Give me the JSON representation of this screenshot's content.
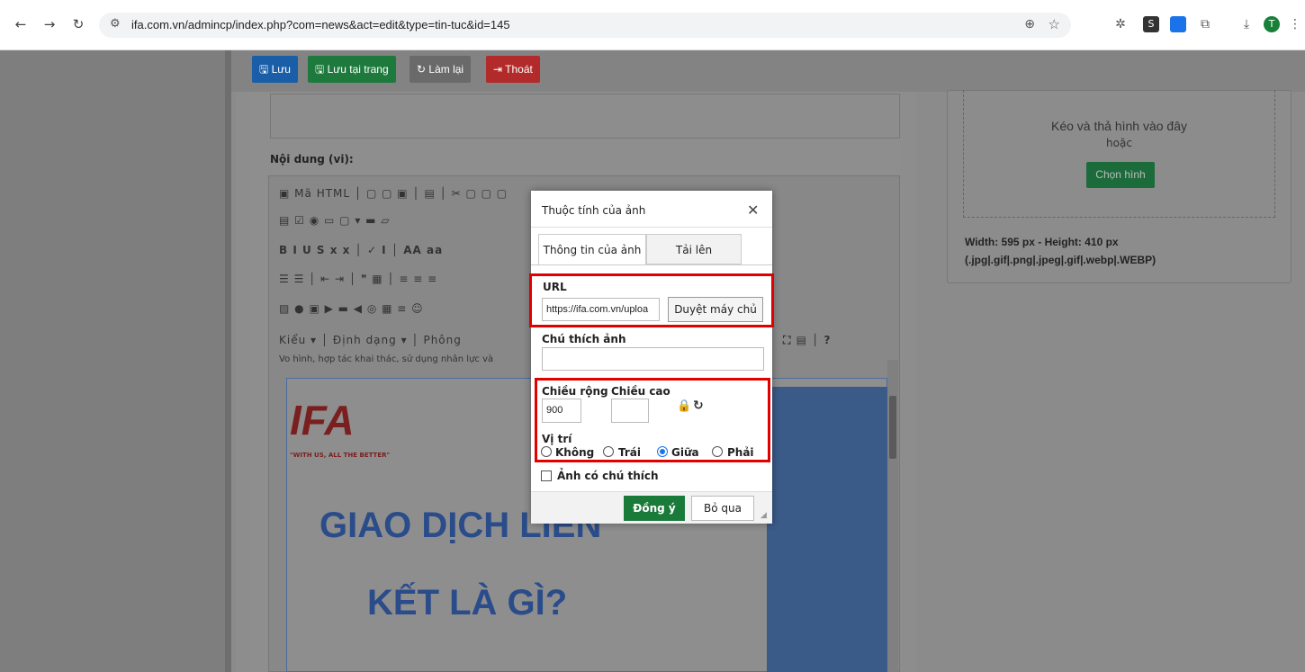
{
  "browser": {
    "url": "ifa.com.vn/admincp/index.php?com=news&act=edit&type=tin-tuc&id=145",
    "profile_initial": "T"
  },
  "toolbar": {
    "save_label": "Lưu",
    "save_stay_label": "Lưu tại trang",
    "reset_label": "Làm lại",
    "exit_label": "Thoát"
  },
  "content": {
    "label": "Nội dung (vi):",
    "html_button": "Mã HTML",
    "style_select": "Kiểu",
    "format_select": "Định dạng",
    "font_select": "Phông",
    "snippet": "Vo hình, hợp tác khai thác, sử dụng nhân lực và",
    "headline_line1": "GIAO DỊCH LIÊN",
    "headline_line2": "KẾT LÀ GÌ?",
    "logo_text": "IFA",
    "logo_slogan": "\"WITH US, ALL THE BETTER\""
  },
  "upload": {
    "drop_text": "Kéo và thả hình vào đây",
    "or_text": "hoặc",
    "choose_button": "Chọn hình",
    "dimensions": "Width: 595 px - Height: 410 px",
    "extensions": "(.jpg|.gif|.png|.jpeg|.gif|.webp|.WEBP)"
  },
  "dialog": {
    "title": "Thuộc tính của ảnh",
    "tab_info": "Thông tin của ảnh",
    "tab_upload": "Tải lên",
    "url_label": "URL",
    "url_value": "https://ifa.com.vn/uploa",
    "browse_button": "Duyệt máy chủ",
    "caption_label": "Chú thích ảnh",
    "caption_value": "",
    "width_label": "Chiều rộng",
    "width_value": "900",
    "height_label": "Chiều cao",
    "height_value": "",
    "align_label": "Vị trí",
    "align_none": "Không",
    "align_left": "Trái",
    "align_center": "Giữa",
    "align_right": "Phải",
    "captioned_label": "Ảnh có chú thích",
    "ok_button": "Đồng ý",
    "cancel_button": "Bỏ qua"
  },
  "colors": {
    "save_blue": "#1a5ea8",
    "save_green": "#1e7a3c",
    "reset_gray": "#6a6a6a",
    "exit_red": "#b22a2a",
    "highlight_red": "#e00000"
  }
}
